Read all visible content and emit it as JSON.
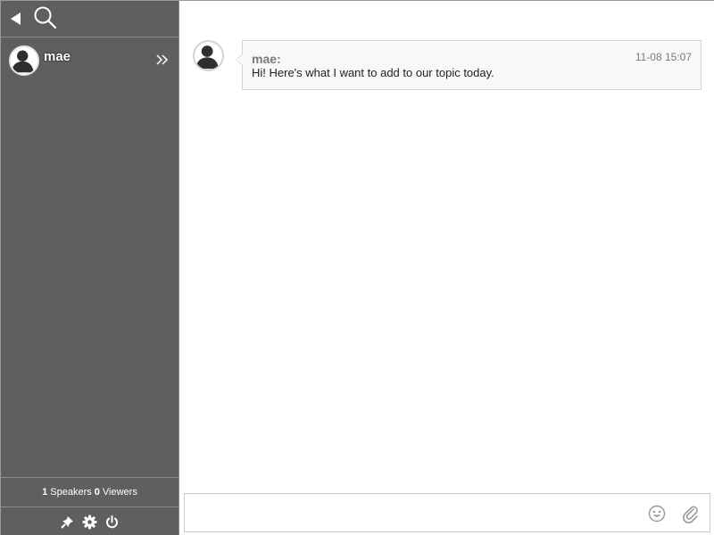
{
  "sidebar": {
    "back_icon": "back-triangle-icon",
    "search_icon": "search-icon",
    "users": [
      {
        "name": "mae",
        "avatar_icon": "user-silhouette-icon",
        "expand_icon": "double-chevron-right-icon"
      }
    ],
    "counts": {
      "speakers_count": "1",
      "speakers_label": "Speakers",
      "viewers_count": "0",
      "viewers_label": "Viewers"
    },
    "tools": [
      "pin-icon",
      "gear-icon",
      "power-icon"
    ]
  },
  "messages": [
    {
      "sender": "mae:",
      "time": "11-08 15:07",
      "text": "Hi! Here's what I want to add to our topic today."
    }
  ],
  "composer": {
    "value": "",
    "placeholder": "",
    "emoji_icon": "smiley-icon",
    "attach_icon": "paperclip-icon"
  },
  "colors": {
    "sidebar_bg": "#5f5f5f",
    "bubble_bg": "#f8f8f8",
    "meta_text": "#7a7a7a"
  }
}
